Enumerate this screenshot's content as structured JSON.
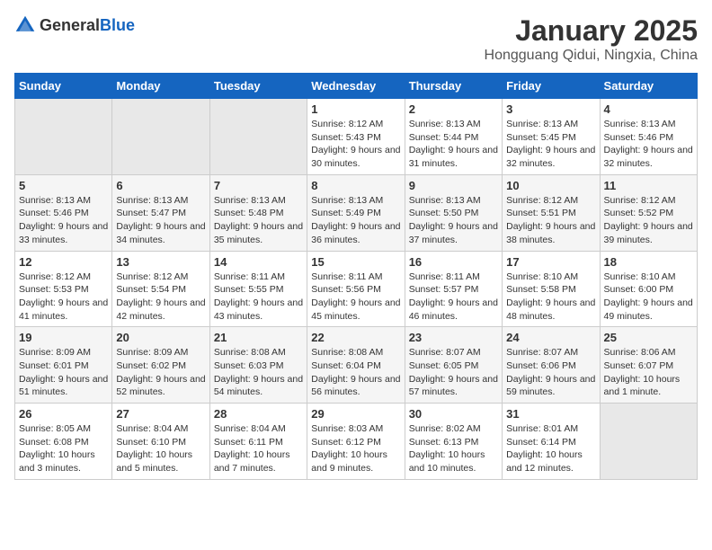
{
  "logo": {
    "general": "General",
    "blue": "Blue"
  },
  "title": "January 2025",
  "subtitle": "Hongguang Qidui, Ningxia, China",
  "headers": [
    "Sunday",
    "Monday",
    "Tuesday",
    "Wednesday",
    "Thursday",
    "Friday",
    "Saturday"
  ],
  "weeks": [
    [
      {
        "day": "",
        "info": ""
      },
      {
        "day": "",
        "info": ""
      },
      {
        "day": "",
        "info": ""
      },
      {
        "day": "1",
        "info": "Sunrise: 8:12 AM\nSunset: 5:43 PM\nDaylight: 9 hours\nand 30 minutes."
      },
      {
        "day": "2",
        "info": "Sunrise: 8:13 AM\nSunset: 5:44 PM\nDaylight: 9 hours\nand 31 minutes."
      },
      {
        "day": "3",
        "info": "Sunrise: 8:13 AM\nSunset: 5:45 PM\nDaylight: 9 hours\nand 32 minutes."
      },
      {
        "day": "4",
        "info": "Sunrise: 8:13 AM\nSunset: 5:46 PM\nDaylight: 9 hours\nand 32 minutes."
      }
    ],
    [
      {
        "day": "5",
        "info": "Sunrise: 8:13 AM\nSunset: 5:46 PM\nDaylight: 9 hours\nand 33 minutes."
      },
      {
        "day": "6",
        "info": "Sunrise: 8:13 AM\nSunset: 5:47 PM\nDaylight: 9 hours\nand 34 minutes."
      },
      {
        "day": "7",
        "info": "Sunrise: 8:13 AM\nSunset: 5:48 PM\nDaylight: 9 hours\nand 35 minutes."
      },
      {
        "day": "8",
        "info": "Sunrise: 8:13 AM\nSunset: 5:49 PM\nDaylight: 9 hours\nand 36 minutes."
      },
      {
        "day": "9",
        "info": "Sunrise: 8:13 AM\nSunset: 5:50 PM\nDaylight: 9 hours\nand 37 minutes."
      },
      {
        "day": "10",
        "info": "Sunrise: 8:12 AM\nSunset: 5:51 PM\nDaylight: 9 hours\nand 38 minutes."
      },
      {
        "day": "11",
        "info": "Sunrise: 8:12 AM\nSunset: 5:52 PM\nDaylight: 9 hours\nand 39 minutes."
      }
    ],
    [
      {
        "day": "12",
        "info": "Sunrise: 8:12 AM\nSunset: 5:53 PM\nDaylight: 9 hours\nand 41 minutes."
      },
      {
        "day": "13",
        "info": "Sunrise: 8:12 AM\nSunset: 5:54 PM\nDaylight: 9 hours\nand 42 minutes."
      },
      {
        "day": "14",
        "info": "Sunrise: 8:11 AM\nSunset: 5:55 PM\nDaylight: 9 hours\nand 43 minutes."
      },
      {
        "day": "15",
        "info": "Sunrise: 8:11 AM\nSunset: 5:56 PM\nDaylight: 9 hours\nand 45 minutes."
      },
      {
        "day": "16",
        "info": "Sunrise: 8:11 AM\nSunset: 5:57 PM\nDaylight: 9 hours\nand 46 minutes."
      },
      {
        "day": "17",
        "info": "Sunrise: 8:10 AM\nSunset: 5:58 PM\nDaylight: 9 hours\nand 48 minutes."
      },
      {
        "day": "18",
        "info": "Sunrise: 8:10 AM\nSunset: 6:00 PM\nDaylight: 9 hours\nand 49 minutes."
      }
    ],
    [
      {
        "day": "19",
        "info": "Sunrise: 8:09 AM\nSunset: 6:01 PM\nDaylight: 9 hours\nand 51 minutes."
      },
      {
        "day": "20",
        "info": "Sunrise: 8:09 AM\nSunset: 6:02 PM\nDaylight: 9 hours\nand 52 minutes."
      },
      {
        "day": "21",
        "info": "Sunrise: 8:08 AM\nSunset: 6:03 PM\nDaylight: 9 hours\nand 54 minutes."
      },
      {
        "day": "22",
        "info": "Sunrise: 8:08 AM\nSunset: 6:04 PM\nDaylight: 9 hours\nand 56 minutes."
      },
      {
        "day": "23",
        "info": "Sunrise: 8:07 AM\nSunset: 6:05 PM\nDaylight: 9 hours\nand 57 minutes."
      },
      {
        "day": "24",
        "info": "Sunrise: 8:07 AM\nSunset: 6:06 PM\nDaylight: 9 hours\nand 59 minutes."
      },
      {
        "day": "25",
        "info": "Sunrise: 8:06 AM\nSunset: 6:07 PM\nDaylight: 10 hours\nand 1 minute."
      }
    ],
    [
      {
        "day": "26",
        "info": "Sunrise: 8:05 AM\nSunset: 6:08 PM\nDaylight: 10 hours\nand 3 minutes."
      },
      {
        "day": "27",
        "info": "Sunrise: 8:04 AM\nSunset: 6:10 PM\nDaylight: 10 hours\nand 5 minutes."
      },
      {
        "day": "28",
        "info": "Sunrise: 8:04 AM\nSunset: 6:11 PM\nDaylight: 10 hours\nand 7 minutes."
      },
      {
        "day": "29",
        "info": "Sunrise: 8:03 AM\nSunset: 6:12 PM\nDaylight: 10 hours\nand 9 minutes."
      },
      {
        "day": "30",
        "info": "Sunrise: 8:02 AM\nSunset: 6:13 PM\nDaylight: 10 hours\nand 10 minutes."
      },
      {
        "day": "31",
        "info": "Sunrise: 8:01 AM\nSunset: 6:14 PM\nDaylight: 10 hours\nand 12 minutes."
      },
      {
        "day": "",
        "info": ""
      }
    ]
  ]
}
